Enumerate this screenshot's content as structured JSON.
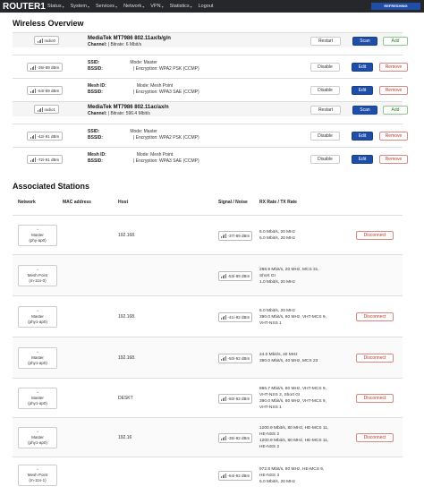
{
  "app": {
    "brand": "ROUTER1",
    "menu": [
      "Status",
      "System",
      "Services",
      "Network",
      "VPN",
      "Statistics",
      "Logout"
    ],
    "refresh_badge": "REFRESHING"
  },
  "wireless": {
    "title": "Wireless Overview",
    "devices": [
      {
        "pill": "radio0",
        "title": "MediaTek MT7986 802.11ax/b/g/n",
        "line2_label": "Channel:",
        "line2_rest": "| Bitrate: 6 Mbit/s",
        "buttons": [
          "Restart",
          "Scan",
          "Add"
        ],
        "networks": [
          {
            "signal": "-35/-89 dBm",
            "l1a": "SSID:",
            "l1b": "Mode: Master",
            "l2a": "BSSID:",
            "l2b": "| Encryption: WPA2 PSK (CCMP)",
            "buttons": [
              "Disable",
              "Edit",
              "Remove"
            ]
          },
          {
            "signal": "-54/-89 dBm",
            "l1a": "Mesh ID:",
            "l1b": "Mode: Mesh Point",
            "l2a": "BSSID:",
            "l2b": "| Encryption: WPA3 SAE (CCMP)",
            "buttons": [
              "Disable",
              "Edit",
              "Remove"
            ]
          }
        ]
      },
      {
        "pill": "radio1",
        "title": "MediaTek MT7986 802.11ac/ax/n",
        "line2_label": "Channel:",
        "line2_rest": "| Bitrate: 596.4 Mbit/s",
        "buttons": [
          "Restart",
          "Scan",
          "Add"
        ],
        "networks": [
          {
            "signal": "-42/-91 dBm",
            "l1a": "SSID:",
            "l1b": "Mode: Master",
            "l2a": "BSSID:",
            "l2b": "| Encryption: WPA2 PSK (CCMP)",
            "buttons": [
              "Disable",
              "Edit",
              "Remove"
            ]
          },
          {
            "signal": "-72/-91 dBm",
            "l1a": "Mesh ID:",
            "l1b": "Mode: Mesh Point",
            "l2a": "BSSID:",
            "l2b": "| Encryption: WPA3 SAE (CCMP)",
            "buttons": [
              "Disable",
              "Edit",
              "Remove"
            ]
          }
        ]
      }
    ]
  },
  "stations": {
    "title": "Associated Stations",
    "headers": [
      "Network",
      "MAC address",
      "Host",
      "Signal / Noise",
      "RX Rate / TX Rate"
    ],
    "disconnect_label": "Disconnect",
    "rows": [
      {
        "net1": "Master",
        "net2": "(phy-ap0)",
        "host": "192.168.",
        "signal": "-37/-89 dBm",
        "rate": [
          "6.0 Mbit/s, 20 MHz",
          "6.0 Mbit/s, 20 MHz"
        ],
        "disconnect": true
      },
      {
        "net1": "Mesh Point",
        "net2": "(m-11s-0)",
        "host": "",
        "signal": "-53/-89 dBm",
        "rate": [
          "288.9 Mbit/s, 20 MHz, MCS 31,",
          "Short GI",
          "1.0 Mbit/s, 20 MHz"
        ],
        "disconnect": false
      },
      {
        "net1": "Master",
        "net2": "(phy1-ap0)",
        "host": "192.168.",
        "signal": "-41/-92 dBm",
        "rate": [
          "6.0 Mbit/s, 20 MHz",
          "390.0 Mbit/s, 80 MHz, VHT-MCS 9,",
          "VHT-NSS 1"
        ],
        "disconnect": true
      },
      {
        "net1": "Master",
        "net2": "(phy1-ap0)",
        "host": "192.168.",
        "signal": "-50/-92 dBm",
        "rate": [
          "24.0 Mbit/s, 40 MHz",
          "390.0 Mbit/s, 40 MHz, MCS 23"
        ],
        "disconnect": true
      },
      {
        "net1": "Master",
        "net2": "(phy1-ap0)",
        "host": "DESKT",
        "signal": "-50/-92 dBm",
        "rate": [
          "866.7 Mbit/s, 80 MHz, VHT-MCS 9,",
          "VHT-NSS 2, Short GI",
          "390.0 Mbit/s, 80 MHz, VHT-MCS 9,",
          "VHT-NSS 1"
        ],
        "disconnect": true
      },
      {
        "net1": "Master",
        "net2": "(phy1-ap0)",
        "host": "192.16",
        "signal": "-35/-92 dBm",
        "rate": [
          "1200.9 Mbit/s, 80 MHz, HE-MCS 11,",
          "HE-NSS 2",
          "1200.9 Mbit/s, 80 MHz, HE-MCS 11,",
          "HE-NSS 2"
        ],
        "disconnect": true
      },
      {
        "net1": "Mesh Point",
        "net2": "(m-11s-1)",
        "host": "",
        "signal": "-64/-92 dBm",
        "rate": [
          "972.8 Mbit/s, 80 MHz, HE-MCS 6,",
          "HE-NSS 3",
          "6.0 Mbit/s, 20 MHz"
        ],
        "disconnect": false
      }
    ]
  }
}
